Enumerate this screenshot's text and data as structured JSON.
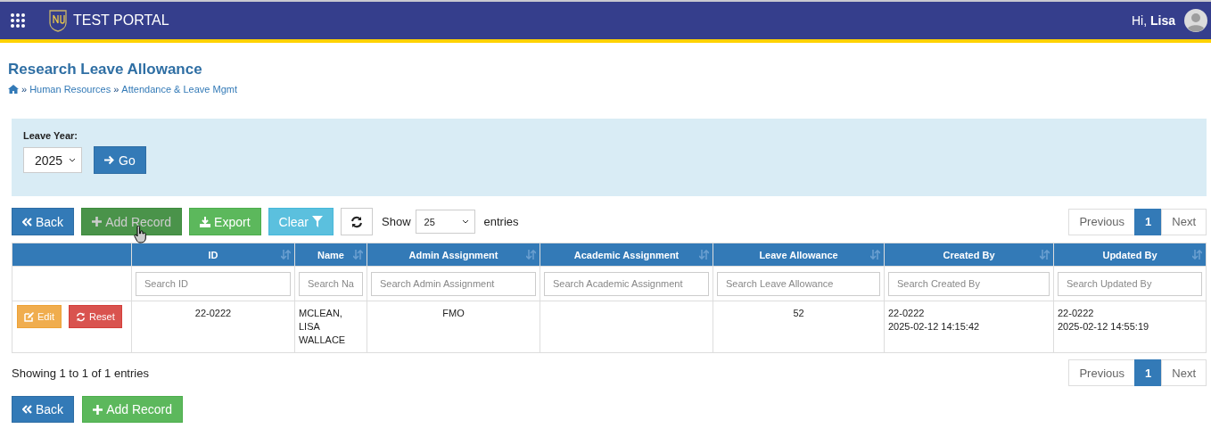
{
  "header": {
    "title": "TEST PORTAL",
    "greeting": "Hi,",
    "user": "Lisa"
  },
  "page": {
    "title": "Research Leave Allowance",
    "breadcrumb": [
      {
        "separator": "»",
        "label": "Human Resources"
      },
      {
        "separator": "»",
        "label": "Attendance & Leave Mgmt"
      }
    ]
  },
  "filter": {
    "label": "Leave Year:",
    "year": "2025",
    "go": "Go"
  },
  "toolbar": [
    {
      "kind": "back",
      "label": "Back",
      "hovered": false
    },
    {
      "kind": "add",
      "label": "Add Record",
      "hovered": true
    },
    {
      "kind": "export",
      "label": "Export",
      "hovered": false
    },
    {
      "kind": "clear",
      "label": "Clear",
      "hovered": false
    },
    {
      "kind": "refresh",
      "hovered": false
    }
  ],
  "length": {
    "before": "Show",
    "value": "25",
    "after": "entries"
  },
  "pagination_top": [
    {
      "label": "Previous",
      "selected": false
    },
    {
      "label": "1",
      "selected": true
    },
    {
      "label": "Next",
      "selected": false
    }
  ],
  "table": {
    "columns": [
      {
        "label": "ID",
        "placeholder": "Search ID"
      },
      {
        "label": "Name",
        "placeholder": "Search Na"
      },
      {
        "label": "Admin Assignment",
        "placeholder": "Search Admin Assignment"
      },
      {
        "label": "Academic Assignment",
        "placeholder": "Search Academic Assignment"
      },
      {
        "label": "Leave Allowance",
        "placeholder": "Search Leave Allowance"
      },
      {
        "label": "Created By",
        "placeholder": "Search Created By"
      },
      {
        "label": "Updated By",
        "placeholder": "Search Updated By"
      }
    ],
    "rows": [
      {
        "actions": [
          {
            "kind": "edit",
            "label": "Edit"
          },
          {
            "kind": "reset",
            "label": "Reset"
          }
        ],
        "cells": [
          [
            "22-0222"
          ],
          [
            "MCLEAN, LISA WALLACE"
          ],
          [
            "FMO"
          ],
          null,
          [
            "52"
          ],
          [
            "22-0222",
            "2025-02-12 14:15:42"
          ],
          [
            "22-0222",
            "2025-02-12 14:55:19"
          ]
        ]
      }
    ]
  },
  "info": "Showing 1 to 1 of 1 entries",
  "pagination_bottom": [
    {
      "label": "Previous",
      "selected": false
    },
    {
      "label": "1",
      "selected": true
    },
    {
      "label": "Next",
      "selected": false
    }
  ],
  "bottom_buttons": [
    {
      "kind": "back",
      "label": "Back",
      "hovered": false
    },
    {
      "kind": "add",
      "label": "Add Record",
      "hovered": false
    }
  ]
}
